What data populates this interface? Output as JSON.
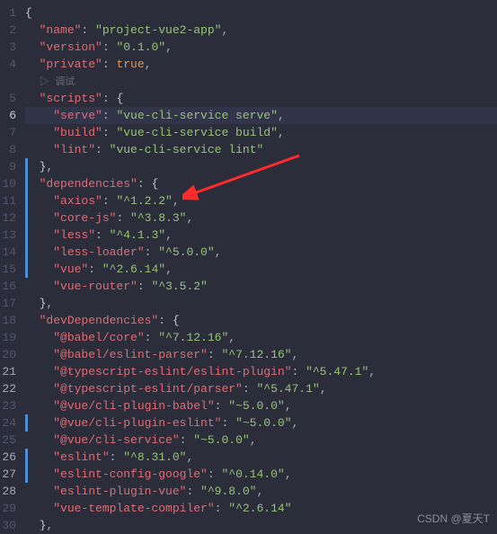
{
  "watermark": "CSDN @夏天T",
  "debug_hint": "▷ 调试",
  "chart_data": {
    "type": "table",
    "title": "package.json",
    "json": {
      "name": "project-vue2-app",
      "version": "0.1.0",
      "private": true,
      "scripts": {
        "serve": "vue-cli-service serve",
        "build": "vue-cli-service build",
        "lint": "vue-cli-service lint"
      },
      "dependencies": {
        "axios": "^1.2.2",
        "core-js": "^3.8.3",
        "less": "^4.1.3",
        "less-loader": "^5.0.0",
        "vue": "^2.6.14",
        "vue-router": "^3.5.2"
      },
      "devDependencies": {
        "@babel/core": "^7.12.16",
        "@babel/eslint-parser": "^7.12.16",
        "@typescript-eslint/eslint-plugin": "^5.47.1",
        "@typescript-eslint/parser": "^5.47.1",
        "@vue/cli-plugin-babel": "~5.0.0",
        "@vue/cli-plugin-eslint": "~5.0.0",
        "@vue/cli-service": "~5.0.0",
        "eslint": "^8.31.0",
        "eslint-config-google": "^0.14.0",
        "eslint-plugin-vue": "^9.8.0",
        "vue-template-compiler": "^2.6.14"
      }
    }
  },
  "lines": [
    {
      "n": 1,
      "indent": 0,
      "tokens": [
        [
          "brace",
          "{"
        ]
      ]
    },
    {
      "n": 2,
      "indent": 1,
      "tokens": [
        [
          "key",
          "\"name\""
        ],
        [
          "punc",
          ": "
        ],
        [
          "str",
          "\"project-vue2-app\""
        ],
        [
          "punc",
          ","
        ]
      ]
    },
    {
      "n": 3,
      "indent": 1,
      "tokens": [
        [
          "key",
          "\"version\""
        ],
        [
          "punc",
          ": "
        ],
        [
          "str",
          "\"0.1.0\""
        ],
        [
          "punc",
          ","
        ]
      ]
    },
    {
      "n": 4,
      "indent": 1,
      "tokens": [
        [
          "key",
          "\"private\""
        ],
        [
          "punc",
          ": "
        ],
        [
          "bool",
          "true"
        ],
        [
          "punc",
          ","
        ]
      ]
    },
    {
      "n": "",
      "indent": 1,
      "debug": true
    },
    {
      "n": 5,
      "indent": 1,
      "tokens": [
        [
          "key",
          "\"scripts\""
        ],
        [
          "punc",
          ": "
        ],
        [
          "brace",
          "{"
        ]
      ]
    },
    {
      "n": 6,
      "indent": 2,
      "active": true,
      "tokens": [
        [
          "key",
          "\"serve\""
        ],
        [
          "punc",
          ": "
        ],
        [
          "str",
          "\"vue-cli-service serve\""
        ],
        [
          "punc",
          ","
        ]
      ]
    },
    {
      "n": 7,
      "indent": 2,
      "tokens": [
        [
          "key",
          "\"build\""
        ],
        [
          "punc",
          ": "
        ],
        [
          "str",
          "\"vue-cli-service build\""
        ],
        [
          "punc",
          ","
        ]
      ]
    },
    {
      "n": 8,
      "indent": 2,
      "tokens": [
        [
          "key",
          "\"lint\""
        ],
        [
          "punc",
          ": "
        ],
        [
          "str",
          "\"vue-cli-service lint\""
        ]
      ]
    },
    {
      "n": 9,
      "indent": 1,
      "tokens": [
        [
          "brace",
          "}"
        ],
        [
          "punc",
          ","
        ]
      ]
    },
    {
      "n": 10,
      "indent": 1,
      "tokens": [
        [
          "key",
          "\"dependencies\""
        ],
        [
          "punc",
          ": "
        ],
        [
          "brace",
          "{"
        ]
      ]
    },
    {
      "n": 11,
      "indent": 2,
      "tokens": [
        [
          "key",
          "\"axios\""
        ],
        [
          "punc",
          ": "
        ],
        [
          "str",
          "\"^1.2.2\""
        ],
        [
          "punc",
          ","
        ]
      ]
    },
    {
      "n": 12,
      "indent": 2,
      "tokens": [
        [
          "key",
          "\"core-js\""
        ],
        [
          "punc",
          ": "
        ],
        [
          "str",
          "\"^3.8.3\""
        ],
        [
          "punc",
          ","
        ]
      ]
    },
    {
      "n": 13,
      "indent": 2,
      "tokens": [
        [
          "key",
          "\"less\""
        ],
        [
          "punc",
          ": "
        ],
        [
          "str",
          "\"^4.1.3\""
        ],
        [
          "punc",
          ","
        ]
      ]
    },
    {
      "n": 14,
      "indent": 2,
      "tokens": [
        [
          "key",
          "\"less-loader\""
        ],
        [
          "punc",
          ": "
        ],
        [
          "str",
          "\"^5.0.0\""
        ],
        [
          "punc",
          ","
        ]
      ]
    },
    {
      "n": 15,
      "indent": 2,
      "tokens": [
        [
          "key",
          "\"vue\""
        ],
        [
          "punc",
          ": "
        ],
        [
          "str",
          "\"^2.6.14\""
        ],
        [
          "punc",
          ","
        ]
      ]
    },
    {
      "n": 16,
      "indent": 2,
      "tokens": [
        [
          "key",
          "\"vue-router\""
        ],
        [
          "punc",
          ": "
        ],
        [
          "str",
          "\"^3.5.2\""
        ]
      ]
    },
    {
      "n": 17,
      "indent": 1,
      "tokens": [
        [
          "brace",
          "}"
        ],
        [
          "punc",
          ","
        ]
      ]
    },
    {
      "n": 18,
      "indent": 1,
      "tokens": [
        [
          "key",
          "\"devDependencies\""
        ],
        [
          "punc",
          ": "
        ],
        [
          "brace",
          "{"
        ]
      ]
    },
    {
      "n": 19,
      "indent": 2,
      "tokens": [
        [
          "key",
          "\"@babel/core\""
        ],
        [
          "punc",
          ": "
        ],
        [
          "str",
          "\"^7.12.16\""
        ],
        [
          "punc",
          ","
        ]
      ]
    },
    {
      "n": 20,
      "indent": 2,
      "tokens": [
        [
          "key",
          "\"@babel/eslint-parser\""
        ],
        [
          "punc",
          ": "
        ],
        [
          "str",
          "\"^7.12.16\""
        ],
        [
          "punc",
          ","
        ]
      ]
    },
    {
      "n": 21,
      "hl": true,
      "indent": 2,
      "tokens": [
        [
          "key",
          "\"@typescript-eslint/eslint-plugin\""
        ],
        [
          "punc",
          ": "
        ],
        [
          "str",
          "\"^5.47.1\""
        ],
        [
          "punc",
          ","
        ]
      ]
    },
    {
      "n": 22,
      "hl": true,
      "indent": 2,
      "tokens": [
        [
          "key",
          "\"@typescript-eslint/parser\""
        ],
        [
          "punc",
          ": "
        ],
        [
          "str",
          "\"^5.47.1\""
        ],
        [
          "punc",
          ","
        ]
      ]
    },
    {
      "n": 23,
      "indent": 2,
      "tokens": [
        [
          "key",
          "\"@vue/cli-plugin-babel\""
        ],
        [
          "punc",
          ": "
        ],
        [
          "str",
          "\"~5.0.0\""
        ],
        [
          "punc",
          ","
        ]
      ]
    },
    {
      "n": 24,
      "indent": 2,
      "tokens": [
        [
          "key",
          "\"@vue/cli-plugin-eslint\""
        ],
        [
          "punc",
          ": "
        ],
        [
          "str",
          "\"~5.0.0\""
        ],
        [
          "punc",
          ","
        ]
      ]
    },
    {
      "n": 25,
      "indent": 2,
      "tokens": [
        [
          "key",
          "\"@vue/cli-service\""
        ],
        [
          "punc",
          ": "
        ],
        [
          "str",
          "\"~5.0.0\""
        ],
        [
          "punc",
          ","
        ]
      ]
    },
    {
      "n": 26,
      "hl": true,
      "indent": 2,
      "tokens": [
        [
          "key",
          "\"eslint\""
        ],
        [
          "punc",
          ": "
        ],
        [
          "str",
          "\"^8.31.0\""
        ],
        [
          "punc",
          ","
        ]
      ]
    },
    {
      "n": 27,
      "hl": true,
      "indent": 2,
      "tokens": [
        [
          "key",
          "\"eslint-config-google\""
        ],
        [
          "punc",
          ": "
        ],
        [
          "str",
          "\"^0.14.0\""
        ],
        [
          "punc",
          ","
        ]
      ]
    },
    {
      "n": 28,
      "hl": true,
      "indent": 2,
      "tokens": [
        [
          "key",
          "\"eslint-plugin-vue\""
        ],
        [
          "punc",
          ": "
        ],
        [
          "str",
          "\"^9.8.0\""
        ],
        [
          "punc",
          ","
        ]
      ]
    },
    {
      "n": 29,
      "indent": 2,
      "tokens": [
        [
          "key",
          "\"vue-template-compiler\""
        ],
        [
          "punc",
          ": "
        ],
        [
          "str",
          "\"^2.6.14\""
        ]
      ]
    },
    {
      "n": 30,
      "indent": 1,
      "tokens": [
        [
          "brace",
          "}"
        ],
        [
          "punc",
          ","
        ]
      ]
    }
  ]
}
